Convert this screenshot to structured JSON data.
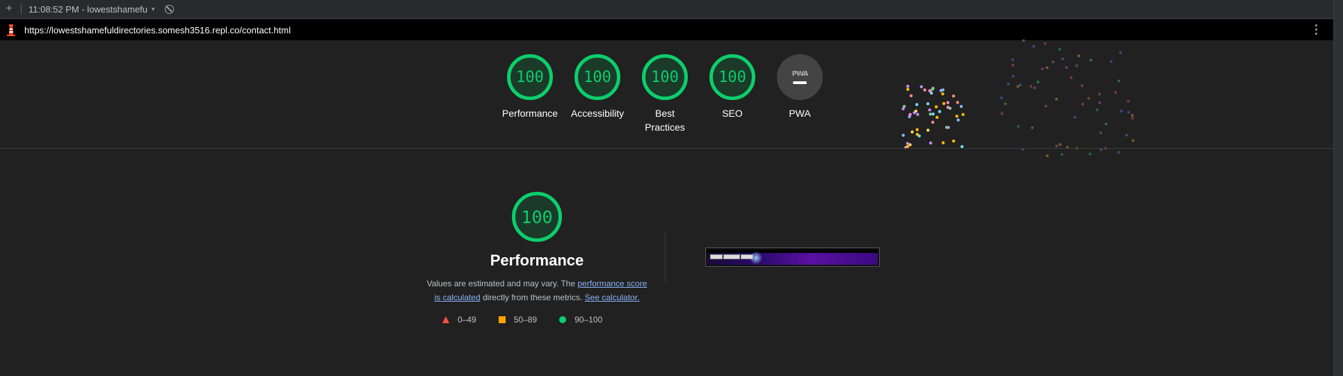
{
  "topbar": {
    "new_tab_symbol": "+",
    "session_label": "11:08:52 PM - lowestshamefu",
    "caret": "▾"
  },
  "urlbar": {
    "url": "https://lowestshamefuldirectories.somesh3516.repl.co/contact.html"
  },
  "gauges": [
    {
      "score": "100",
      "label": "Performance"
    },
    {
      "score": "100",
      "label": "Accessibility"
    },
    {
      "score": "100",
      "label": "Best Practices"
    },
    {
      "score": "100",
      "label": "SEO"
    },
    {
      "score": "",
      "label": "PWA",
      "badge_text": "PWA"
    }
  ],
  "performance": {
    "score": "100",
    "title": "Performance",
    "desc_prefix": "Values are estimated and may vary. The ",
    "link1": "performance score is calculated",
    "desc_middle": " directly from these metrics. ",
    "link2": "See calculator."
  },
  "legend": [
    {
      "range": "0–49",
      "color": "#ff4e42",
      "shape": "triangle"
    },
    {
      "range": "50–89",
      "color": "#ffa400",
      "shape": "square"
    },
    {
      "range": "90–100",
      "color": "#0cce6b",
      "shape": "circle"
    }
  ],
  "colors": {
    "pass": "#0cce6b",
    "background": "#212121",
    "link": "#8ab4f8"
  }
}
